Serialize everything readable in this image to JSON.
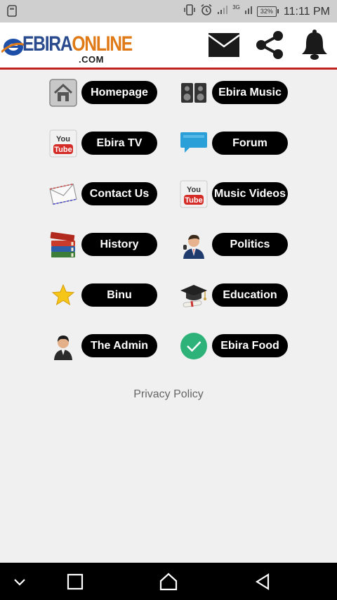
{
  "status_bar": {
    "time": "11:11 PM",
    "battery": "32%",
    "network": "3G"
  },
  "app": {
    "logo_main_a": "EBIRA",
    "logo_main_b": "ONLINE",
    "logo_sub": ".COM",
    "brand_colors": {
      "blue": "#2a4a8e",
      "orange": "#e07a17",
      "rule": "#c0231f"
    }
  },
  "menu": [
    {
      "label": "Homepage",
      "icon": "home-icon"
    },
    {
      "label": "Ebira Music",
      "icon": "speakers-icon"
    },
    {
      "label": "Ebira TV",
      "icon": "youtube-icon"
    },
    {
      "label": "Forum",
      "icon": "chat-bubble-icon"
    },
    {
      "label": "Contact Us",
      "icon": "envelope-icon"
    },
    {
      "label": "Music Videos",
      "icon": "youtube-icon"
    },
    {
      "label": "History",
      "icon": "books-icon"
    },
    {
      "label": "Politics",
      "icon": "politician-icon"
    },
    {
      "label": "Binu",
      "icon": "star-icon"
    },
    {
      "label": "Education",
      "icon": "graduation-cap-icon"
    },
    {
      "label": "The Admin",
      "icon": "admin-user-icon"
    },
    {
      "label": "Ebira Food",
      "icon": "check-circle-icon"
    }
  ],
  "footer": {
    "privacy": "Privacy Policy"
  }
}
